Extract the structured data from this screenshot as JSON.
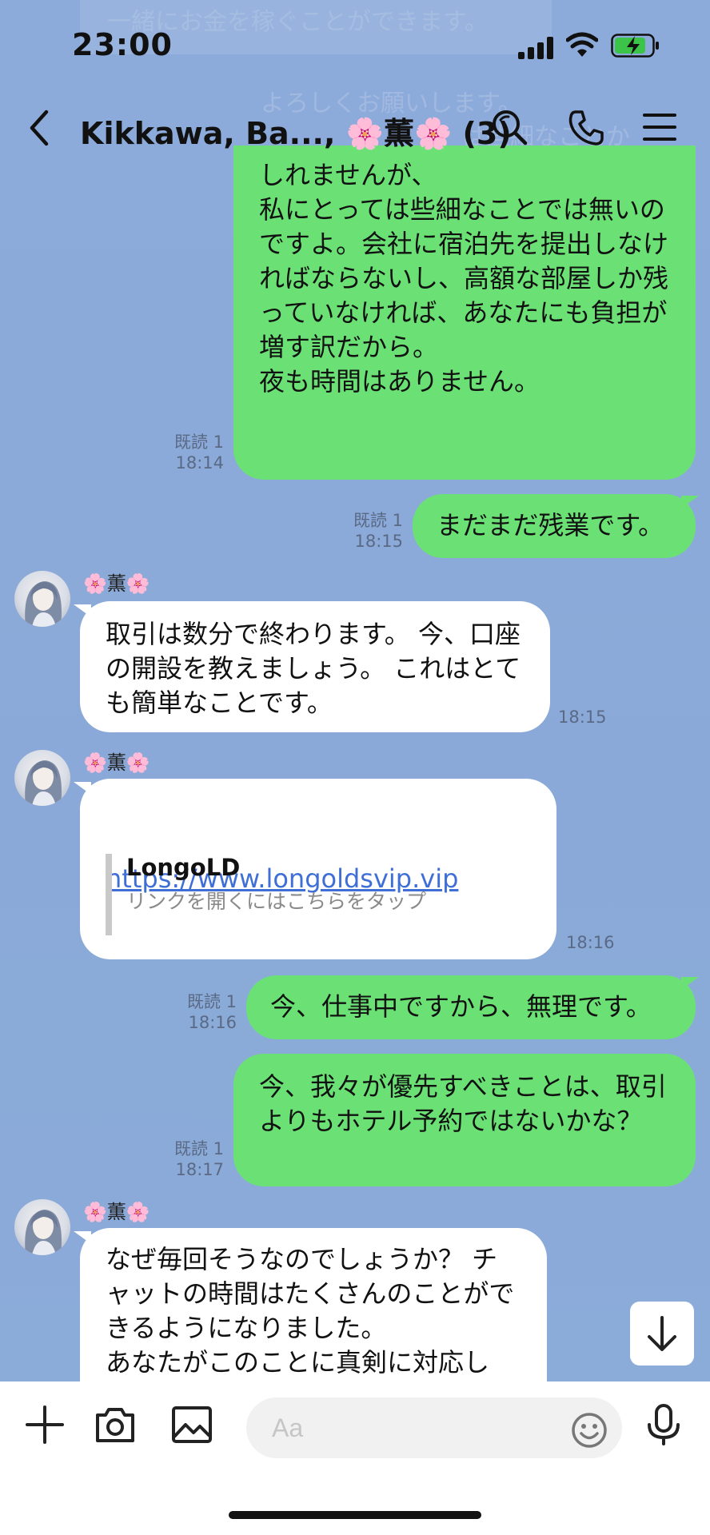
{
  "status_bar": {
    "time": "23:00"
  },
  "header": {
    "title": "Kikkawa, Ba..., 🌸薫🌸 (3)"
  },
  "background_ghost": {
    "line1": "一緒にお金を稼ぐことができます。",
    "line2": "よろしくお願いします。",
    "line3": "は些細なことか"
  },
  "messages": [
    {
      "direction": "out",
      "text": "しれませんが、\n私にとっては些細なことでは無いのですよ。会社に宿泊先を提出しなければならないし、高額な部屋しか残っていなければ、あなたにも負担が増す訳だから。\n夜も時間はありません。",
      "read": "既読 1",
      "time": "18:14"
    },
    {
      "direction": "out",
      "text": "まだまだ残業です。",
      "read": "既読 1",
      "time": "18:15"
    },
    {
      "direction": "in",
      "sender": "🌸薫🌸",
      "text": "取引は数分で終わります。 今、口座の開設を教えましょう。 これはとても簡単なことです。",
      "time": "18:15"
    },
    {
      "direction": "in",
      "sender": "🌸薫🌸",
      "link": "https://www.longoldsvip.vip",
      "preview_title": "LongoLD",
      "preview_desc": "リンクを開くにはこちらをタップ",
      "time": "18:16"
    },
    {
      "direction": "out",
      "text": "今、仕事中ですから、無理です。",
      "read": "既読 1",
      "time": "18:16"
    },
    {
      "direction": "out",
      "text": "今、我々が優先すべきことは、取引よりもホテル予約ではないかな？",
      "read": "既読 1",
      "time": "18:17"
    },
    {
      "direction": "in",
      "sender": "🌸薫🌸",
      "text": "なぜ毎回そうなのでしょうか？ チャットの時間はたくさんのことができるようになりました。\nあなたがこのことに真剣に対応し"
    }
  ],
  "composer": {
    "placeholder": "Aa",
    "value": ""
  },
  "colors": {
    "outgoing": "#6BE175",
    "incoming": "#FFFFFF",
    "background": "#8CABD9",
    "link": "#3F6FD6"
  },
  "icons": [
    "back-icon",
    "search-icon",
    "phone-icon",
    "menu-icon",
    "plus-icon",
    "camera-icon",
    "image-icon",
    "emoji-icon",
    "mic-icon",
    "arrow-down-icon"
  ]
}
